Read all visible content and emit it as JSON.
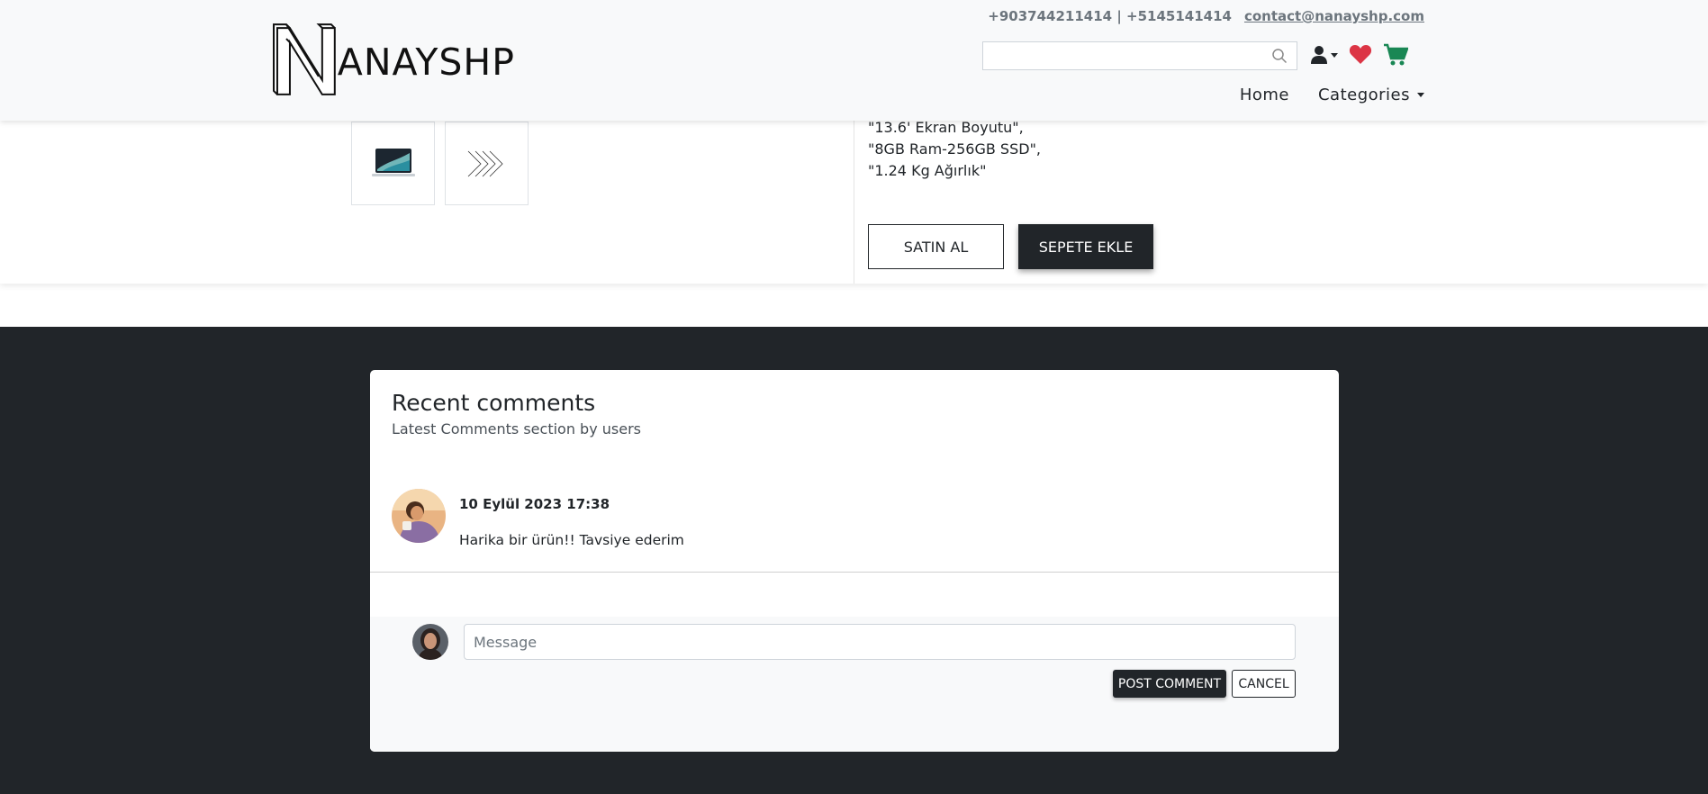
{
  "header": {
    "logo_text": "ANAYSHP",
    "phones": "+903744211414 | +5145141414",
    "email": "contact@nanayshp.com",
    "search_placeholder": "",
    "nav": {
      "home": "Home",
      "categories": "Categories"
    }
  },
  "product": {
    "specs": [
      "\"13.6' Ekran Boyutu\",",
      "\"8GB Ram-256GB SSD\",",
      "\"1.24 Kg Ağırlık\""
    ],
    "buy_label": "SATIN AL",
    "cart_label": "SEPETE EKLE"
  },
  "comments": {
    "title": "Recent comments",
    "subtitle": "Latest Comments section by users",
    "items": [
      {
        "date": "10 Eylül 2023 17:38",
        "text": "Harika bir ürün!! Tavsiye ederim"
      }
    ],
    "composer": {
      "placeholder": "Message",
      "post_label": "POST COMMENT",
      "cancel_label": "CANCEL"
    }
  },
  "colors": {
    "dark": "#212529",
    "heart": "#dc3545",
    "cart": "#198754"
  }
}
